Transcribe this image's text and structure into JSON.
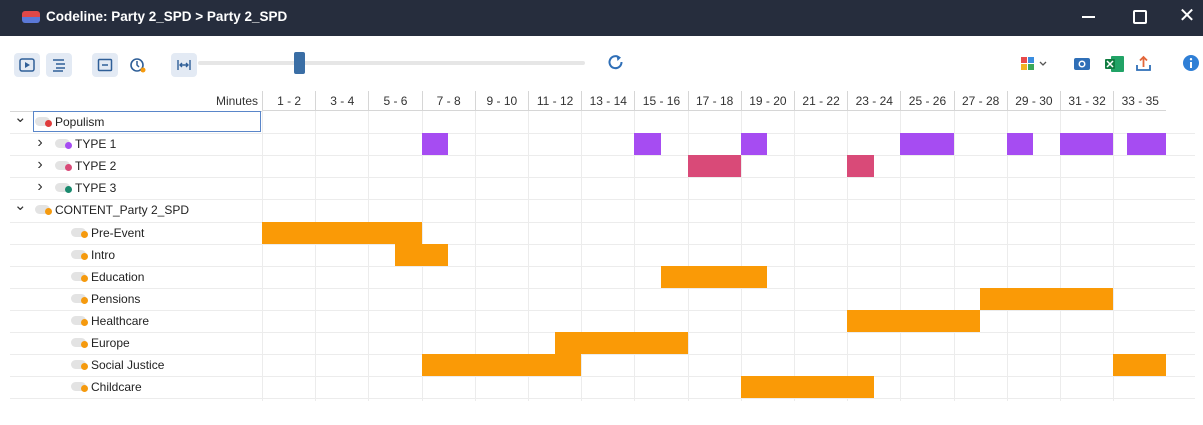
{
  "window": {
    "title": "Codeline: Party 2_SPD > Party 2_SPD",
    "close_glyph": "✕"
  },
  "toolbar": {
    "left_buttons": [
      "play-icon",
      "list-outline-icon",
      "table-view-icon",
      "clock-icon",
      "fit-width-icon"
    ],
    "slider_value": 0.26,
    "right_buttons": [
      "refresh-icon",
      "color-palette-icon",
      "camera-icon",
      "excel-icon",
      "export-icon",
      "info-icon"
    ]
  },
  "header": {
    "minutes_label": "Minutes",
    "columns": [
      "1 - 2",
      "3 - 4",
      "5 - 6",
      "7 - 8",
      "9 - 10",
      "11 - 12",
      "13 - 14",
      "15 - 16",
      "17 - 18",
      "19 - 20",
      "21 - 22",
      "23 - 24",
      "25 - 26",
      "27 - 28",
      "29 - 30",
      "31 - 32",
      "33 - 35"
    ]
  },
  "rows": [
    {
      "label": "Populism",
      "level": 0,
      "chevron": "down",
      "dot": "#e03c3c",
      "selected": true
    },
    {
      "label": "TYPE 1",
      "level": 1,
      "chevron": "right",
      "dot": "#a64cf2"
    },
    {
      "label": "TYPE 2",
      "level": 1,
      "chevron": "right",
      "dot": "#d94a78"
    },
    {
      "label": "TYPE 3",
      "level": 1,
      "chevron": "right",
      "dot": "#1a8a6e"
    },
    {
      "label": "CONTENT_Party 2_SPD",
      "level": 0,
      "chevron": "down",
      "dot": "#f59a0e"
    },
    {
      "label": "Pre-Event",
      "level": 2,
      "dot": "#f59a0e"
    },
    {
      "label": "Intro",
      "level": 2,
      "dot": "#f59a0e"
    },
    {
      "label": "Education",
      "level": 2,
      "dot": "#f59a0e"
    },
    {
      "label": "Pensions",
      "level": 2,
      "dot": "#f59a0e"
    },
    {
      "label": "Healthcare",
      "level": 2,
      "dot": "#f59a0e"
    },
    {
      "label": "Europe",
      "level": 2,
      "dot": "#f59a0e"
    },
    {
      "label": "Social Justice",
      "level": 2,
      "dot": "#f59a0e"
    },
    {
      "label": "Childcare",
      "level": 2,
      "dot": "#f59a0e"
    }
  ],
  "colors": {
    "type1": "#a64cf2",
    "type2": "#d94a78",
    "content": "#fa9a06"
  },
  "segments": [
    {
      "row": 1,
      "start": 7,
      "end": 8,
      "color": "type1"
    },
    {
      "row": 1,
      "start": 15,
      "end": 16,
      "color": "type1"
    },
    {
      "row": 1,
      "start": 19,
      "end": 20,
      "color": "type1"
    },
    {
      "row": 1,
      "start": 25,
      "end": 27,
      "color": "type1"
    },
    {
      "row": 1,
      "start": 29,
      "end": 30,
      "color": "type1"
    },
    {
      "row": 1,
      "start": 31,
      "end": 33,
      "color": "type1"
    },
    {
      "row": 1,
      "start": 33.5,
      "end": 35,
      "color": "type1"
    },
    {
      "row": 2,
      "start": 17,
      "end": 19,
      "color": "type2"
    },
    {
      "row": 2,
      "start": 23,
      "end": 24,
      "color": "type2"
    },
    {
      "row": 5,
      "start": 1,
      "end": 7,
      "color": "content"
    },
    {
      "row": 6,
      "start": 6,
      "end": 8,
      "color": "content"
    },
    {
      "row": 7,
      "start": 16,
      "end": 20,
      "color": "content"
    },
    {
      "row": 8,
      "start": 28,
      "end": 33,
      "color": "content"
    },
    {
      "row": 9,
      "start": 23,
      "end": 28,
      "color": "content"
    },
    {
      "row": 10,
      "start": 12,
      "end": 17,
      "color": "content"
    },
    {
      "row": 11,
      "start": 7,
      "end": 13,
      "color": "content"
    },
    {
      "row": 11,
      "start": 33,
      "end": 35,
      "color": "content"
    },
    {
      "row": 12,
      "start": 19,
      "end": 24,
      "color": "content"
    }
  ]
}
